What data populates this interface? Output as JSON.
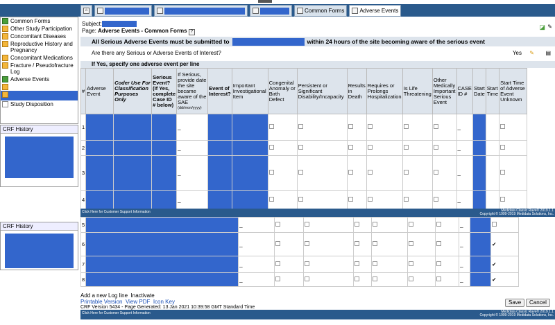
{
  "tabs": [
    "Common Forms",
    "Adverse Events"
  ],
  "nav": [
    {
      "label": "Common Forms",
      "icon": "green"
    },
    {
      "label": "Other Study Participation",
      "icon": "orange"
    },
    {
      "label": "Concomitant Diseases",
      "icon": "orange"
    },
    {
      "label": "Reproductive History and Pregnancy",
      "icon": "orange"
    },
    {
      "label": "Concomitant Medications",
      "icon": "orange"
    },
    {
      "label": "Fracture / Pseudofracture Log",
      "icon": "orange"
    },
    {
      "label": "Adverse Events",
      "icon": "green"
    },
    {
      "label": "",
      "icon": "orange"
    },
    {
      "label": "",
      "icon": "orange"
    },
    {
      "label": "Study Disposition",
      "icon": "doc"
    }
  ],
  "crf_history": "CRF History",
  "subject_label": "Subject:",
  "page_label": "Page:",
  "page_name": "Adverse Events - Common Forms",
  "notice_pre": "All Serious Adverse Events must be submitted to",
  "notice_post": "within 24 hours of the site becoming aware of the serious event",
  "question": "Are there any Serious or Adverse Events of Interest?",
  "question_answer": "Yes",
  "specify": "If Yes, specify one adverse event per line",
  "columns": [
    "#",
    "Adverse Event",
    "Coder Use For Classification Purposes Only",
    "Serious Event? (If Yes, complete Case ID # below)",
    "If Serious, provide date the site became aware of the SAE",
    "Event of Interest?",
    "Important Investigational Item",
    "Congenital Anomaly or Birth Defect",
    "Persistent or Significant Disability/Incapacity",
    "Results in Death",
    "Requires or Prolongs Hospitalization",
    "Is Life Threatening",
    "Other Medically Important Serious Event",
    "CASE ID #",
    "Start Date",
    "Start Time",
    "Start Time of Adverse Event Unknown"
  ],
  "date_format": "(dd/mon/yyyy)",
  "rows": [
    "1",
    "2",
    "3",
    "4",
    "5",
    "6",
    "7",
    "8"
  ],
  "add_line": "Add a new Log line",
  "inactivate": "Inactivate",
  "links": [
    "Printable Version",
    "View PDF",
    "Icon Key"
  ],
  "crf_version": "CRF Version 5434 - Page Generated: 13 Jan 2021 10:39:58 GMT Standard Time",
  "support": "Click Here for Customer Support Information",
  "copyright1": "Medidata Classic Rave® 2019.1.1",
  "copyright2": "Copyright © 1999-2019 Medidata Solutions, Inc.",
  "save": "Save",
  "cancel": "Cancel"
}
